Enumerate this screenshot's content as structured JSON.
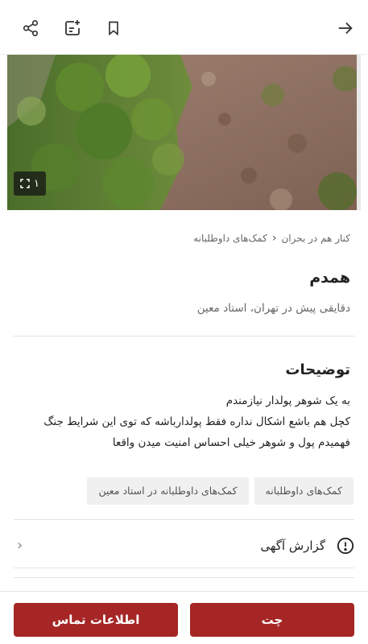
{
  "colors": {
    "primary": "#a62626",
    "text": "#222222",
    "muted": "#666666",
    "tag_bg": "#f0f0f0"
  },
  "topbar": {
    "icons": [
      "share-icon",
      "add-note-icon",
      "bookmark-icon",
      "arrow-right-icon"
    ]
  },
  "gallery": {
    "count": "۱"
  },
  "breadcrumb": {
    "items": [
      "کنار هم در بحران",
      "کمک‌های داوطلبانه"
    ]
  },
  "post": {
    "title": "همدم",
    "meta": "دقایقی پیش در تهران، استاد معین"
  },
  "description": {
    "heading": "توضیحات",
    "lines": [
      "به یک شوهر پولدار نیازمندم",
      "کچل هم باشع اشکال نداره فقط پولدارباشه که توی این شرایط جنگ",
      "فهمیدم پول و شوهر خیلی احساس امنیت میدن واقعا"
    ]
  },
  "tags": [
    "کمک‌های داوطلبانه",
    "کمک‌های داوطلبانه در استاد معین"
  ],
  "report": {
    "label": "گزارش آگهی"
  },
  "actions": {
    "chat": "چت",
    "contact": "اطلاعات تماس"
  }
}
